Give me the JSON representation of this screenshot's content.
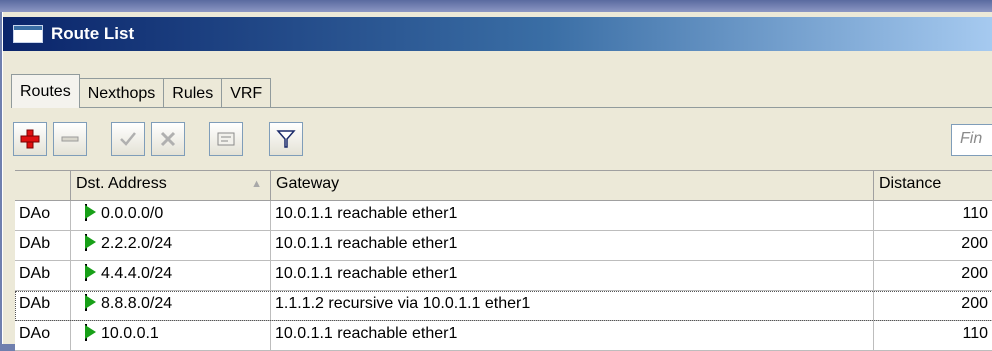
{
  "window": {
    "title": "Route List",
    "title_icon": "window-icon"
  },
  "tabs": [
    {
      "label": "Routes",
      "active": true
    },
    {
      "label": "Nexthops",
      "active": false
    },
    {
      "label": "Rules",
      "active": false
    },
    {
      "label": "VRF",
      "active": false
    }
  ],
  "toolbar": {
    "buttons": [
      "add-icon",
      "remove-icon",
      "enable-icon",
      "disable-icon",
      "comment-icon",
      "filter-icon"
    ],
    "find_placeholder": "Fin"
  },
  "table": {
    "columns": [
      "",
      "Dst. Address",
      "Gateway",
      "Distance"
    ],
    "sort_indicator": "▲",
    "rows": [
      {
        "flags": "DAo",
        "dst": "0.0.0.0/0",
        "gateway": "10.0.1.1 reachable ether1",
        "distance": "110"
      },
      {
        "flags": "DAb",
        "dst": "2.2.2.0/24",
        "gateway": "10.0.1.1 reachable ether1",
        "distance": "200"
      },
      {
        "flags": "DAb",
        "dst": "4.4.4.0/24",
        "gateway": "10.0.1.1 reachable ether1",
        "distance": "200"
      },
      {
        "flags": "DAb",
        "dst": "8.8.8.0/24",
        "gateway": "1.1.1.2 recursive via 10.0.1.1 ether1",
        "distance": "200"
      },
      {
        "flags": "DAo",
        "dst": "10.0.0.1",
        "gateway": "10.0.1.1 reachable ether1",
        "distance": "110"
      }
    ]
  },
  "colors": {
    "active_route_flag": "#18a018",
    "titlebar": "#0a246a",
    "add_icon": "#e01010"
  }
}
